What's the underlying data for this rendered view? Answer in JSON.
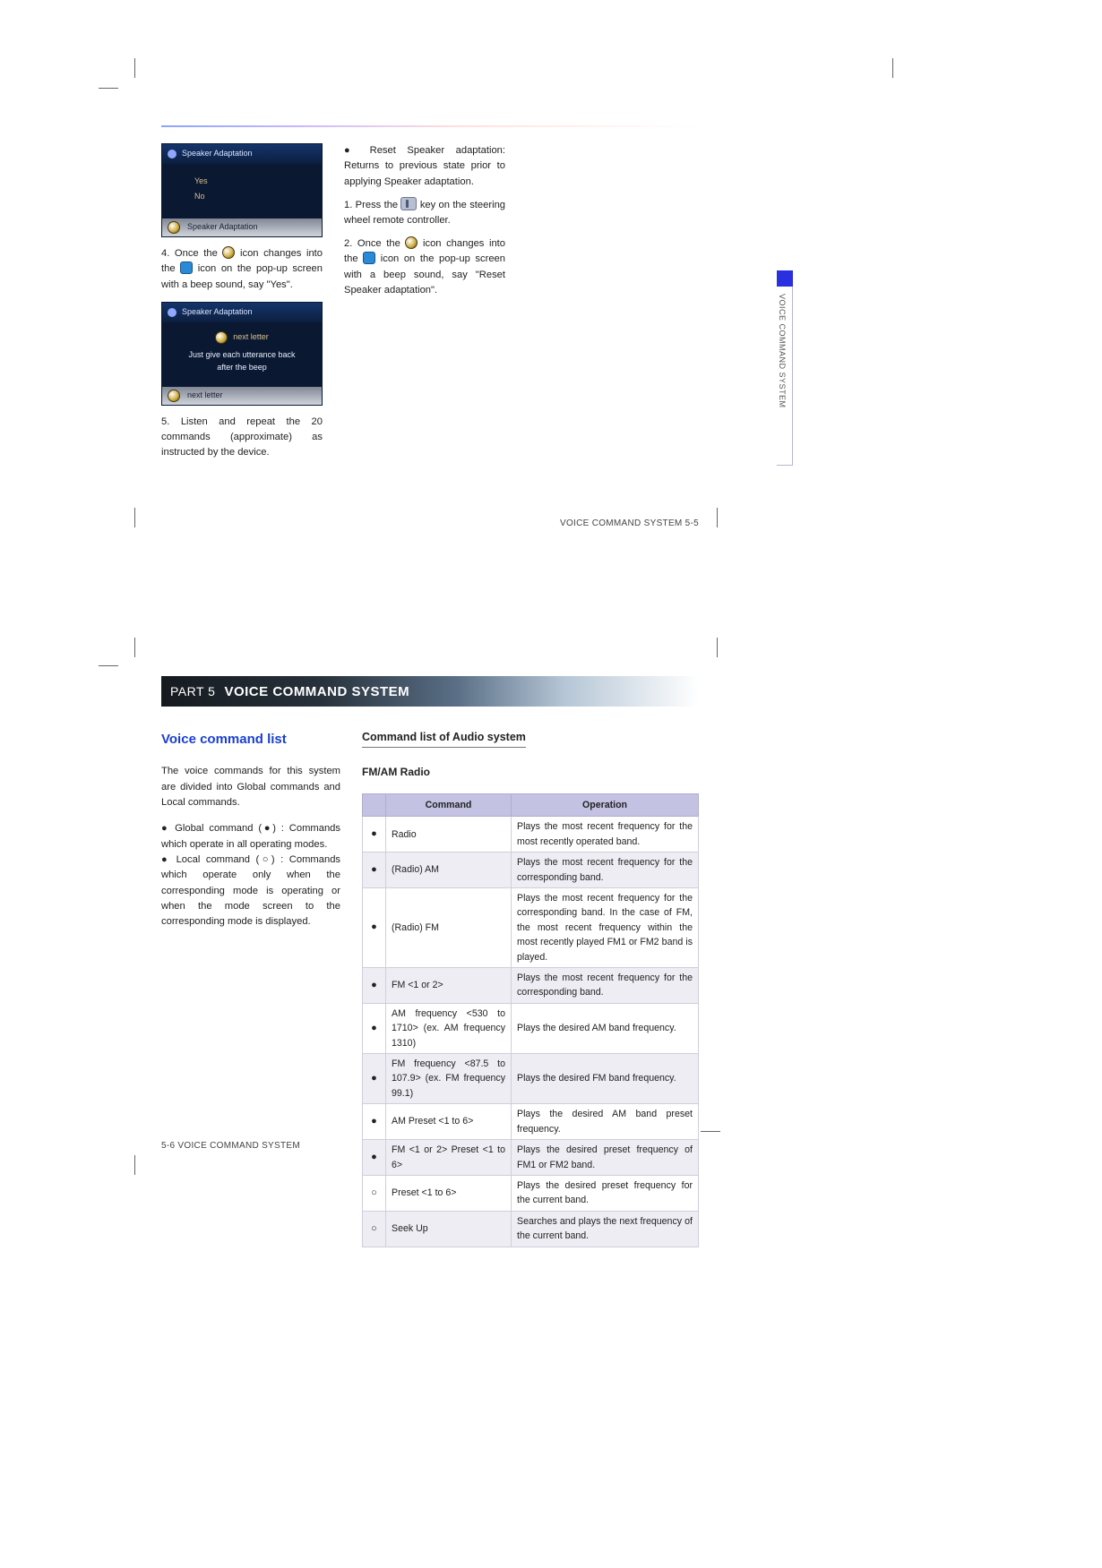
{
  "top": {
    "ui1": {
      "title": "Speaker Adaptation",
      "yes": "Yes",
      "no": "No",
      "status": "Speaker Adaptation"
    },
    "step4_a": "4. Once the ",
    "step4_b": " icon changes into the ",
    "step4_c": " icon on the pop-up screen with a beep sound, say \"Yes\".",
    "ui2": {
      "title": "Speaker Adaptation",
      "icon_label": "next letter",
      "instr1": "Just give each utterance back",
      "instr2": "after the beep",
      "status": "next letter"
    },
    "step5": "5. Listen and repeat the 20 commands (approximate) as instructed by the device.",
    "col2_bullet": "Reset Speaker adaptation: Returns to previous state prior to applying Speaker adaptation.",
    "col2_step1_a": "1. Press the ",
    "col2_step1_b": " key on the steering wheel remote controller.",
    "col2_step2_a": "2. Once the ",
    "col2_step2_b": " icon changes into the ",
    "col2_step2_c": " icon on the pop-up screen with a beep sound, say \"Reset Speaker adaptation\".",
    "side_tab": "VOICE COMMAND SYSTEM",
    "footer": "VOICE COMMAND SYSTEM   5-5"
  },
  "bottom": {
    "part": "PART 5",
    "title": "VOICE COMMAND SYSTEM",
    "section": "Voice command list",
    "intro": "The voice commands for this system are divided into Global commands and Local commands.",
    "global_a": "Global command (",
    "global_b": ") : Commands which operate in all operating modes.",
    "local_a": "Local command (",
    "local_b": ") : Commands which operate only when the corresponding mode is operating or when the mode screen to the corresponding mode is displayed.",
    "sub_heading": "Command list of Audio system",
    "sub_sub": "FM/AM Radio",
    "th_cmd": "Command",
    "th_op": "Operation",
    "rows": [
      {
        "m": "●",
        "c": "Radio",
        "o": "Plays the most recent frequency for the most recently operated band."
      },
      {
        "m": "●",
        "c": "(Radio) AM",
        "o": "Plays the most recent frequency for the corresponding band."
      },
      {
        "m": "●",
        "c": "(Radio) FM",
        "o": "Plays the most recent frequency for the corresponding band. In the case of FM, the most recent frequency within the most recently played FM1 or FM2 band is played."
      },
      {
        "m": "●",
        "c": "FM <1 or 2>",
        "o": "Plays the most recent frequency for the corresponding band."
      },
      {
        "m": "●",
        "c": "AM frequency <530 to 1710> (ex. AM frequency 1310)",
        "o": "Plays the desired AM band frequency."
      },
      {
        "m": "●",
        "c": "FM frequency <87.5 to 107.9> (ex. FM frequency 99.1)",
        "o": "Plays the desired FM band frequency."
      },
      {
        "m": "●",
        "c": "AM Preset <1 to 6>",
        "o": "Plays the desired AM band preset frequency."
      },
      {
        "m": "●",
        "c": "FM <1 or 2> Preset <1 to 6>",
        "o": "Plays the desired preset frequency of FM1 or FM2 band."
      },
      {
        "m": "○",
        "c": "Preset <1 to 6>",
        "o": "Plays the desired preset frequency for the current band."
      },
      {
        "m": "○",
        "c": "Seek Up",
        "o": "Searches and plays the next frequency of the current band."
      }
    ],
    "footer": "5-6   VOICE COMMAND SYSTEM"
  }
}
